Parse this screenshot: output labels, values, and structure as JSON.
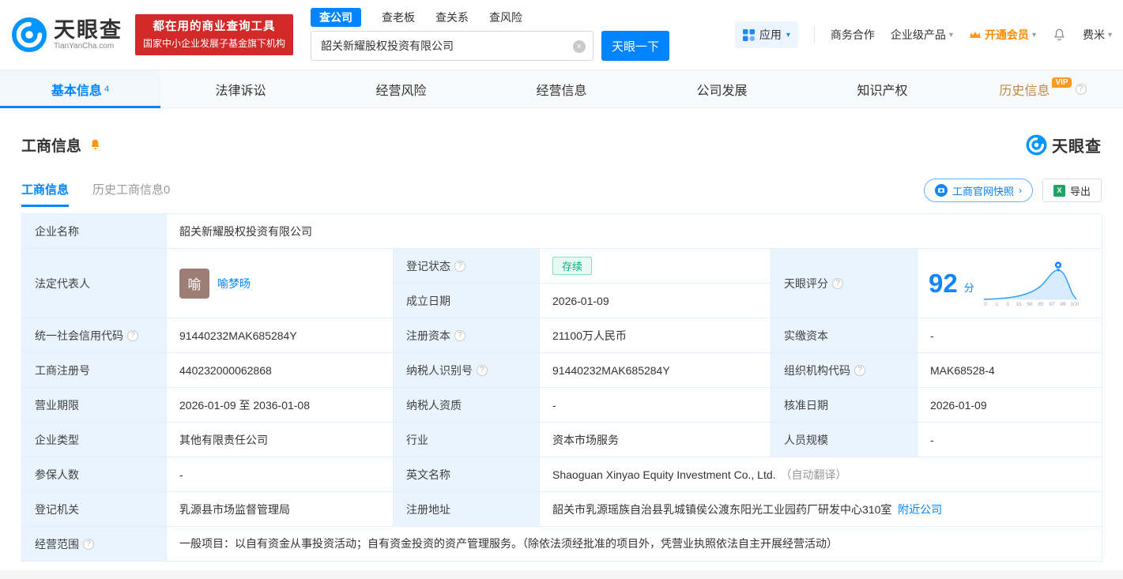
{
  "colors": {
    "accent": "#0084ff",
    "banner_red": "#d12a28",
    "status_green": "#00b47e",
    "vip_orange": "#ff9a1f",
    "label_bg": "#e9f4fe"
  },
  "icons": {
    "help": "?",
    "caret": "▾",
    "chevron_right": "›",
    "close": "×",
    "excel": "X"
  },
  "brand": {
    "logo_text": "天眼查",
    "logo_domain": "TianYanCha.com",
    "banner_line1": "都在用的商业查询工具",
    "banner_line2": "国家中小企业发展子基金旗下机构"
  },
  "search": {
    "tabs": [
      "查公司",
      "查老板",
      "查关系",
      "查风险"
    ],
    "value": "韶关新耀股权投资有限公司",
    "button": "天眼一下"
  },
  "topnav": {
    "apps": "应用",
    "biz": "商务合作",
    "enterprise": "企业级产品",
    "vip": "开通会员",
    "user": "费米"
  },
  "tabs": {
    "basic": "基本信息",
    "basic_count": "4",
    "lawsuit": "法律诉讼",
    "risk": "经营风险",
    "operation": "经营信息",
    "development": "公司发展",
    "ip": "知识产权",
    "history": "历史信息",
    "history_badge": "VIP"
  },
  "section": {
    "title": "工商信息",
    "subtab_active": "工商信息",
    "subtab_history": "历史工商信息0",
    "snapshot_button": "工商官网快照",
    "export_button": "导出"
  },
  "table": {
    "company_name_label": "企业名称",
    "company_name": "韶关新耀股权投资有限公司",
    "legal_rep_label": "法定代表人",
    "legal_rep_avatar": "喻",
    "legal_rep_name": "喻梦旸",
    "reg_status_label": "登记状态",
    "reg_status": "存续",
    "establish_label": "成立日期",
    "establish_date": "2026-01-09",
    "score_label": "天眼评分",
    "score": "92",
    "score_unit": "分",
    "score_ticks": [
      "0",
      "1",
      "3",
      "15",
      "56",
      "85",
      "97",
      "99",
      "100"
    ],
    "credit_code_label": "统一社会信用代码",
    "credit_code": "91440232MAK685284Y",
    "reg_capital_label": "注册资本",
    "reg_capital": "21100万人民币",
    "paid_capital_label": "实缴资本",
    "paid_capital": "-",
    "reg_number_label": "工商注册号",
    "reg_number": "440232000062868",
    "taxpayer_id_label": "纳税人识别号",
    "taxpayer_id": "91440232MAK685284Y",
    "org_code_label": "组织机构代码",
    "org_code": "MAK68528-4",
    "business_term_label": "营业期限",
    "business_term": "2026-01-09 至 2036-01-08",
    "taxpayer_quality_label": "纳税人资质",
    "taxpayer_quality": "-",
    "approval_date_label": "核准日期",
    "approval_date": "2026-01-09",
    "company_type_label": "企业类型",
    "company_type": "其他有限责任公司",
    "industry_label": "行业",
    "industry": "资本市场服务",
    "staff_size_label": "人员规模",
    "staff_size": "-",
    "insured_label": "参保人数",
    "insured": "-",
    "english_name_label": "英文名称",
    "english_name": "Shaoguan Xinyao Equity Investment Co., Ltd.",
    "english_name_note": "（自动翻译）",
    "reg_authority_label": "登记机关",
    "reg_authority": "乳源县市场监督管理局",
    "address_label": "注册地址",
    "address": "韶关市乳源瑶族自治县乳城镇侯公渡东阳光工业园药厂研发中心310室",
    "nearby_link": "附近公司",
    "scope_label": "经营范围",
    "scope": "一般项目：以自有资金从事投资活动；自有资金投资的资产管理服务。（除依法须经批准的项目外，凭营业执照依法自主开展经营活动）"
  }
}
